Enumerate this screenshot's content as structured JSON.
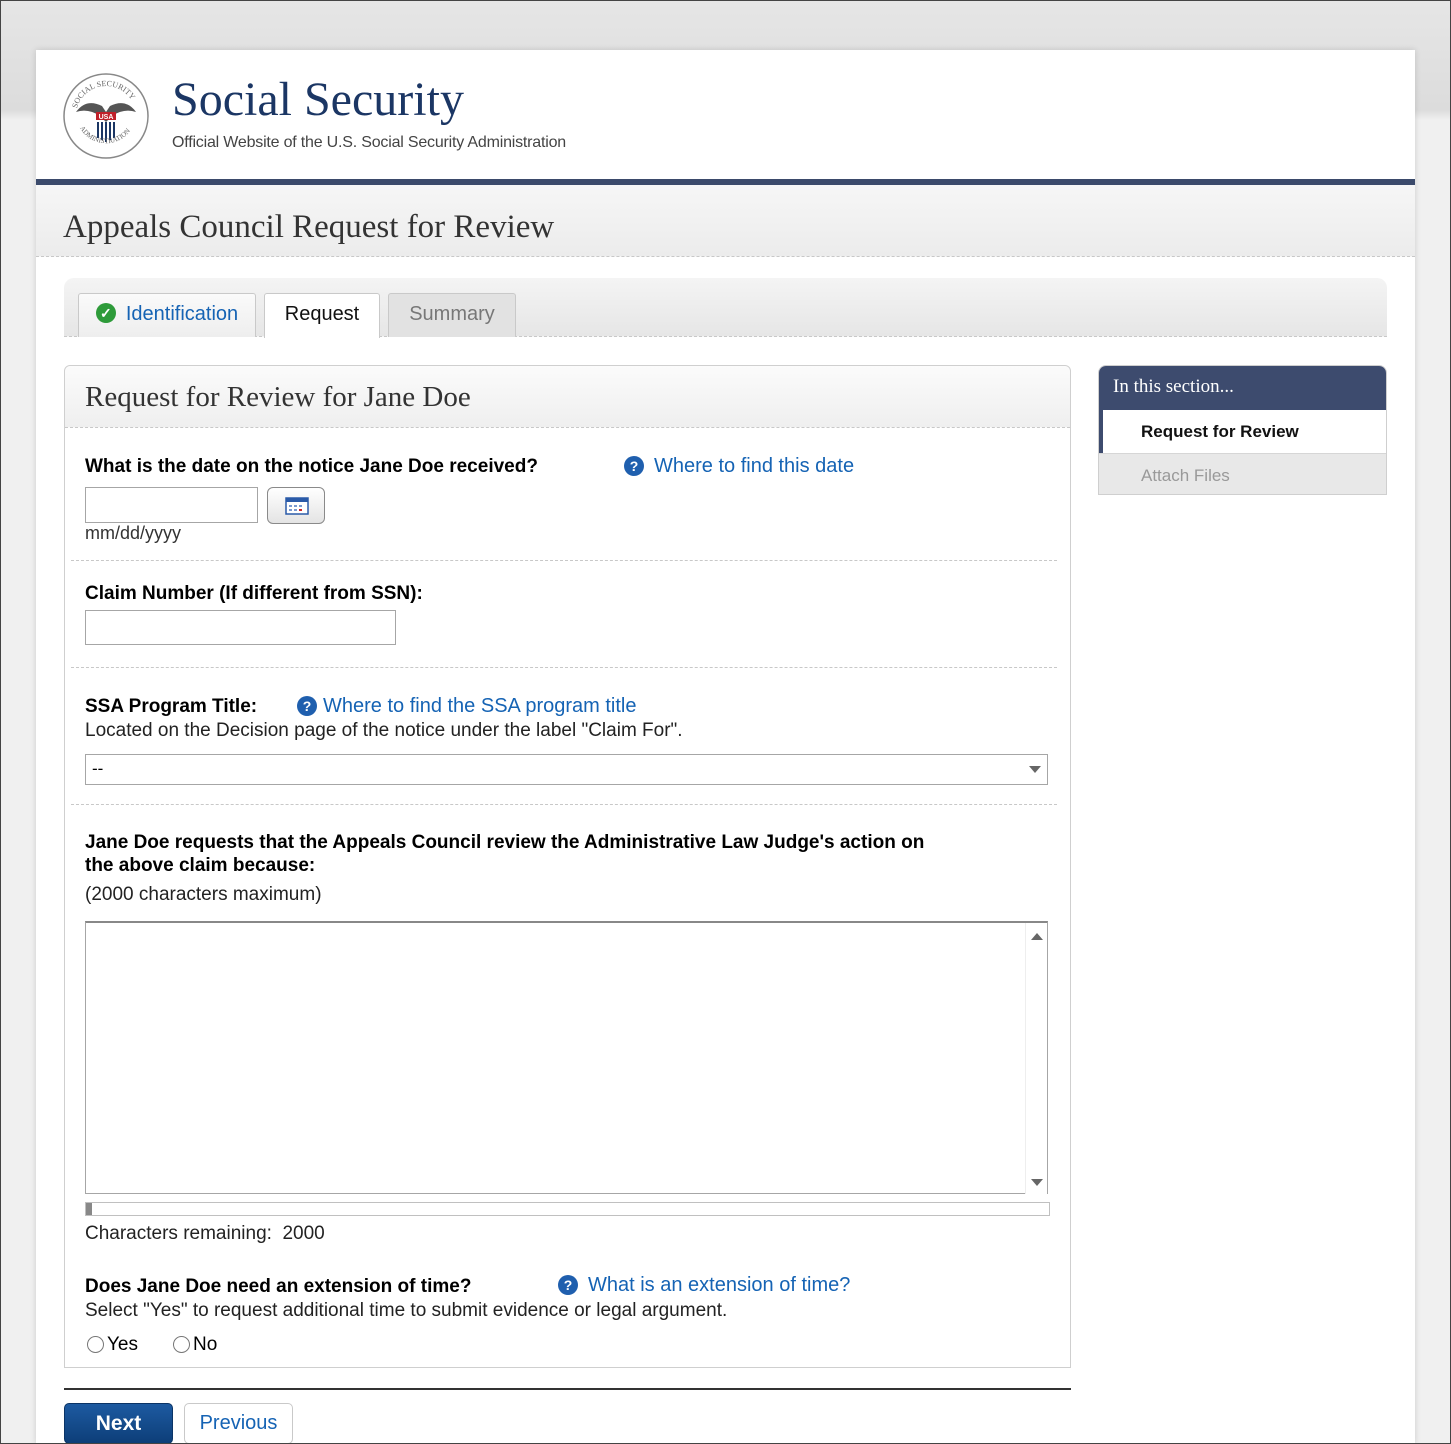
{
  "header": {
    "brand_title": "Social Security",
    "brand_subtitle": "Official Website of the U.S. Social Security Administration",
    "seal_text": "SOCIAL SECURITY ADMINISTRATION USA",
    "brand_color": "#1b3664"
  },
  "page": {
    "title": "Appeals Council Request for Review"
  },
  "tabs": [
    {
      "label": "Identification",
      "state": "completed",
      "icon": "check-circle-icon"
    },
    {
      "label": "Request",
      "state": "active"
    },
    {
      "label": "Summary",
      "state": "disabled"
    }
  ],
  "form": {
    "title": "Request for Review for Jane Doe",
    "notice_date": {
      "label": "What is the date on the notice Jane Doe received?",
      "help_link": "Where to find this date",
      "value": "",
      "hint": "mm/dd/yyyy"
    },
    "claim_number": {
      "label": "Claim Number (If different from SSN):",
      "value": ""
    },
    "program_title": {
      "label": "SSA Program Title:",
      "help_link": "Where to find the SSA program title",
      "description": "Located on the Decision page of the notice under the label \"Claim For\".",
      "selected": "--"
    },
    "reason": {
      "label_line1": "Jane Doe requests that the Appeals Council review the Administrative Law Judge's action on",
      "label_line2": "the above claim because:",
      "hint": "(2000 characters maximum)",
      "value": "",
      "remaining_label": "Characters remaining:",
      "remaining_count": "2000",
      "used_fraction": 0
    },
    "extension": {
      "label": "Does Jane Doe need an extension of time?",
      "help_link": "What is an extension of time?",
      "description": "Select \"Yes\" to request additional time to submit evidence or legal argument.",
      "options": [
        "Yes",
        "No"
      ],
      "selected": null
    }
  },
  "sidebar": {
    "heading": "In this section...",
    "items": [
      {
        "label": "Request for Review",
        "state": "active"
      },
      {
        "label": "Attach Files",
        "state": "disabled"
      }
    ]
  },
  "buttons": {
    "next": "Next",
    "previous": "Previous"
  },
  "colors": {
    "navy": "#3b4a6b",
    "link": "#1563b4",
    "success": "#2e9b3a",
    "primary_button": "#0d3e78"
  }
}
